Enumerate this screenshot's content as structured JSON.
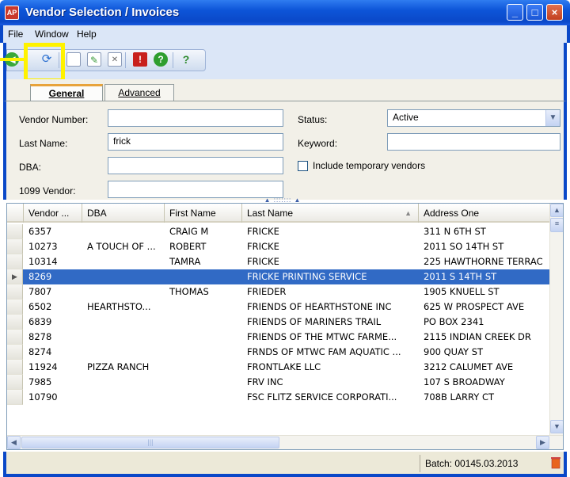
{
  "window": {
    "title": "Vendor Selection / Invoices",
    "app_icon_text": "AP",
    "controls": [
      "_",
      "□",
      "×"
    ]
  },
  "menu": {
    "items": [
      "File",
      "Window",
      "Help"
    ]
  },
  "toolbar": {
    "buttons": [
      "back-icon",
      "refresh-icon",
      "new-icon",
      "edit-icon",
      "delete-icon",
      "stop-icon",
      "ok-icon",
      "help-icon"
    ],
    "highlighted": "refresh-icon",
    "highlight_color": "#fff200"
  },
  "tabs": [
    {
      "label": "General",
      "active": true
    },
    {
      "label": "Advanced",
      "active": false
    }
  ],
  "form": {
    "vendor_number_label": "Vendor Number:",
    "vendor_number_value": "",
    "last_name_label": "Last Name:",
    "last_name_value": "frick",
    "dba_label": "DBA:",
    "dba_value": "",
    "vendor_1099_label": "1099 Vendor:",
    "vendor_1099_value": "",
    "status_label": "Status:",
    "status_value": "Active",
    "keyword_label": "Keyword:",
    "keyword_value": "",
    "include_temp_label": "Include temporary vendors",
    "include_temp_checked": false
  },
  "grid": {
    "columns": [
      "Vendor ...",
      "DBA",
      "First Name",
      "Last Name",
      "Address One"
    ],
    "sorted_column": "Last Name",
    "selected_row": 3,
    "rows": [
      [
        "6357",
        "",
        "CRAIG M",
        "FRICKE",
        "311 N 6TH ST"
      ],
      [
        "10273",
        "A TOUCH OF ...",
        "ROBERT",
        "FRICKE",
        "2011 SO 14TH ST"
      ],
      [
        "10314",
        "",
        "TAMRA",
        "FRICKE",
        "225 HAWTHORNE TERRAC"
      ],
      [
        "8269",
        "",
        "",
        "FRICKE PRINTING SERVICE",
        "2011 S 14TH ST"
      ],
      [
        "7807",
        "",
        "THOMAS",
        "FRIEDER",
        "1905 KNUELL ST"
      ],
      [
        "6502",
        "HEARTHSTO...",
        "",
        "FRIENDS OF HEARTHSTONE INC",
        "625 W PROSPECT AVE"
      ],
      [
        "6839",
        "",
        "",
        "FRIENDS OF MARINERS TRAIL",
        "PO BOX 2341"
      ],
      [
        "8278",
        "",
        "",
        "FRIENDS OF THE MTWC FARME...",
        "2115 INDIAN CREEK DR"
      ],
      [
        "8274",
        "",
        "",
        "FRNDS OF MTWC FAM AQUATIC ...",
        "900 QUAY ST"
      ],
      [
        "11924",
        "PIZZA RANCH",
        "",
        "FRONTLAKE LLC",
        "3212 CALUMET AVE"
      ],
      [
        "7985",
        "",
        "",
        "FRV INC",
        "107 S BROADWAY"
      ],
      [
        "10790",
        "",
        "",
        "FSC FLITZ SERVICE CORPORATI...",
        "708B LARRY CT"
      ]
    ]
  },
  "status": {
    "batch": "Batch: 00145.03.2013"
  }
}
